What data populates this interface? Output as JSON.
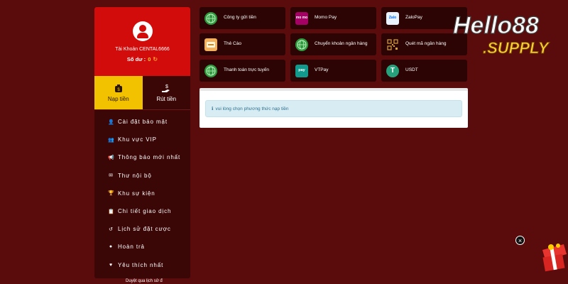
{
  "profile": {
    "account_label": "Tài Khoản CENTAL6666",
    "balance_label": "Số dư :",
    "balance_value": "0"
  },
  "tabs": [
    {
      "label": "Nạp tiền",
      "icon": "money-bag-icon",
      "active": true
    },
    {
      "label": "Rút tiền",
      "icon": "hand-money-icon",
      "active": false
    }
  ],
  "menu": [
    {
      "label": "Cài đặt bảo mật",
      "icon": "user-gear-icon"
    },
    {
      "label": "Khu vực VIP",
      "icon": "users-icon"
    },
    {
      "label": "Thông báo mới nhất",
      "icon": "megaphone-icon"
    },
    {
      "label": "Thư nội bộ",
      "icon": "envelope-icon"
    },
    {
      "label": "Khu sự kiện",
      "icon": "trophy-icon"
    },
    {
      "label": "Chi tiết giao dịch",
      "icon": "clipboard-icon"
    },
    {
      "label": "Lịch sử đặt cược",
      "icon": "history-icon"
    },
    {
      "label": "Hoàn trả",
      "icon": "coin-icon"
    },
    {
      "label": "Yêu thích nhất",
      "icon": "heart-icon"
    }
  ],
  "footer_text": "Duyệt qua lịch sử đ",
  "payments": [
    {
      "label": "Công ty gửi tiền",
      "icon": "globe-icon"
    },
    {
      "label": "Momo Pay",
      "icon": "momo-icon",
      "icon_text": "mo mo"
    },
    {
      "label": "ZaloPay",
      "icon": "zalopay-icon",
      "icon_text": "Zalo"
    },
    {
      "label": "Thẻ Cào",
      "icon": "scratch-card-icon"
    },
    {
      "label": "Chuyển khoản ngân hàng",
      "icon": "globe-icon"
    },
    {
      "label": "Quét mã ngân hàng",
      "icon": "qr-code-icon"
    },
    {
      "label": "Thanh toán trực tuyến",
      "icon": "globe-icon"
    },
    {
      "label": "VTPay",
      "icon": "vtpay-icon",
      "icon_text": "pay"
    },
    {
      "label": "USDT",
      "icon": "usdt-icon",
      "icon_text": "T"
    }
  ],
  "alert_text": "vui lòng chọn phương thức nạp tiền",
  "logo": {
    "line1": "Hello88",
    "line2": ".SUPPLY"
  },
  "colors": {
    "accent_red": "#d20b0b",
    "active_tab": "#f2c200",
    "background": "#5a0b0b"
  }
}
